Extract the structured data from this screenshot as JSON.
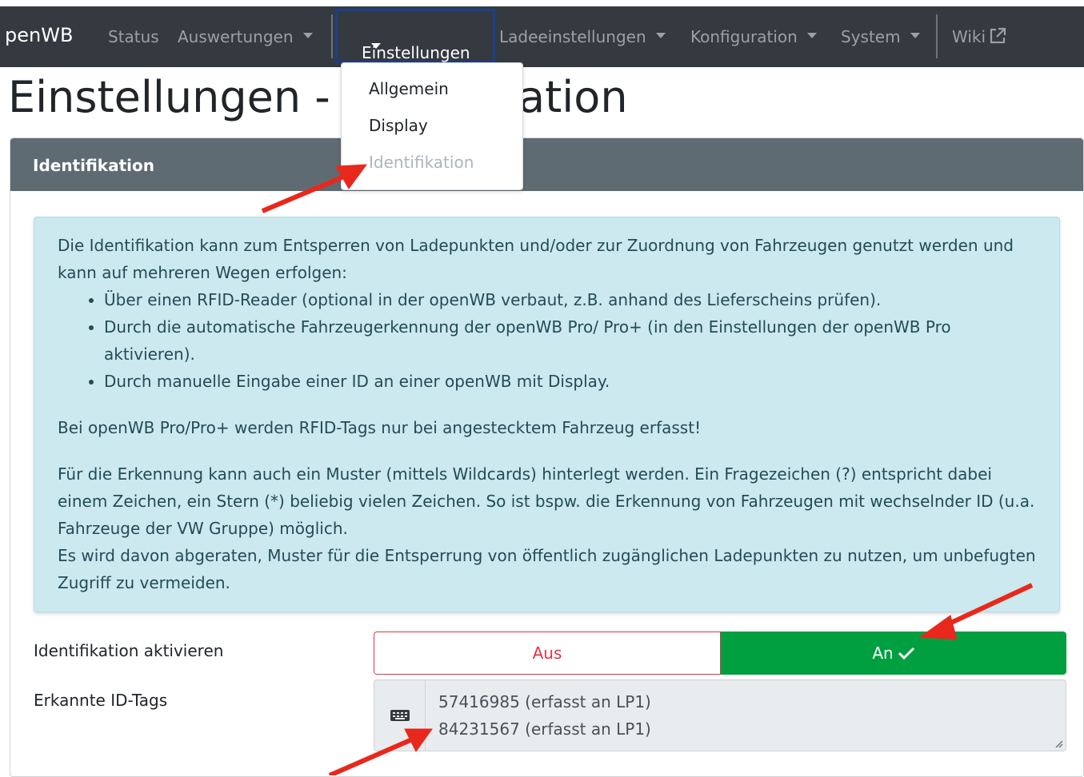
{
  "navbar": {
    "brand": "penWB",
    "items": [
      {
        "label": "Status"
      },
      {
        "label": "Auswertungen"
      },
      {
        "label": "Einstellungen"
      },
      {
        "label": "Ladeeinstellungen"
      },
      {
        "label": "Konfiguration"
      },
      {
        "label": "System"
      },
      {
        "label": "Wiki"
      }
    ]
  },
  "dropdown": {
    "items": [
      {
        "label": "Allgemein"
      },
      {
        "label": "Display"
      },
      {
        "label": "Identifikation"
      }
    ]
  },
  "page": {
    "title": "Einstellungen - Identifikation"
  },
  "card": {
    "header": "Identifikation",
    "info": {
      "intro": "Die Identifikation kann zum Entsperren von Ladepunkten und/oder zur Zuordnung von Fahrzeugen genutzt werden und kann auf mehreren Wegen erfolgen:",
      "bullets": [
        "Über einen RFID-Reader (optional in der openWB verbaut, z.B. anhand des Lieferscheins prüfen).",
        "Durch die automatische Fahrzeugerkennung der openWB Pro/ Pro+ (in den Einstellungen der openWB Pro aktivieren).",
        "Durch manuelle Eingabe einer ID an einer openWB mit Display."
      ],
      "note": "Bei openWB Pro/Pro+ werden RFID-Tags nur bei angestecktem Fahrzeug erfasst!",
      "pattern": "Für die Erkennung kann auch ein Muster (mittels Wildcards) hinterlegt werden. Ein Fragezeichen (?) entspricht dabei einem Zeichen, ein Stern (*) beliebig vielen Zeichen. So ist bspw. die Erkennung von Fahrzeugen mit wechselnder ID (u.a. Fahrzeuge der VW Gruppe) möglich.",
      "warning": "Es wird davon abgeraten, Muster für die Entsperrung von öffentlich zugänglichen Ladepunkten zu nutzen, um unbefugten Zugriff zu vermeiden."
    },
    "activate": {
      "label": "Identifikation aktivieren",
      "off": "Aus",
      "on": "An",
      "value": "An"
    },
    "tags": {
      "label": "Erkannte ID-Tags",
      "lines": [
        "57416985 (erfasst an LP1)",
        "84231567 (erfasst an LP1)"
      ]
    }
  },
  "colors": {
    "navbar": "#343a40",
    "card_header": "#5f6b73",
    "alert_bg": "#cbe9ee",
    "success": "#00a040",
    "danger": "#dc3545",
    "annotation_arrow": "#e8281c"
  },
  "icons": [
    "external-link-icon",
    "keyboard-icon",
    "check-icon",
    "caret-down-icon"
  ]
}
